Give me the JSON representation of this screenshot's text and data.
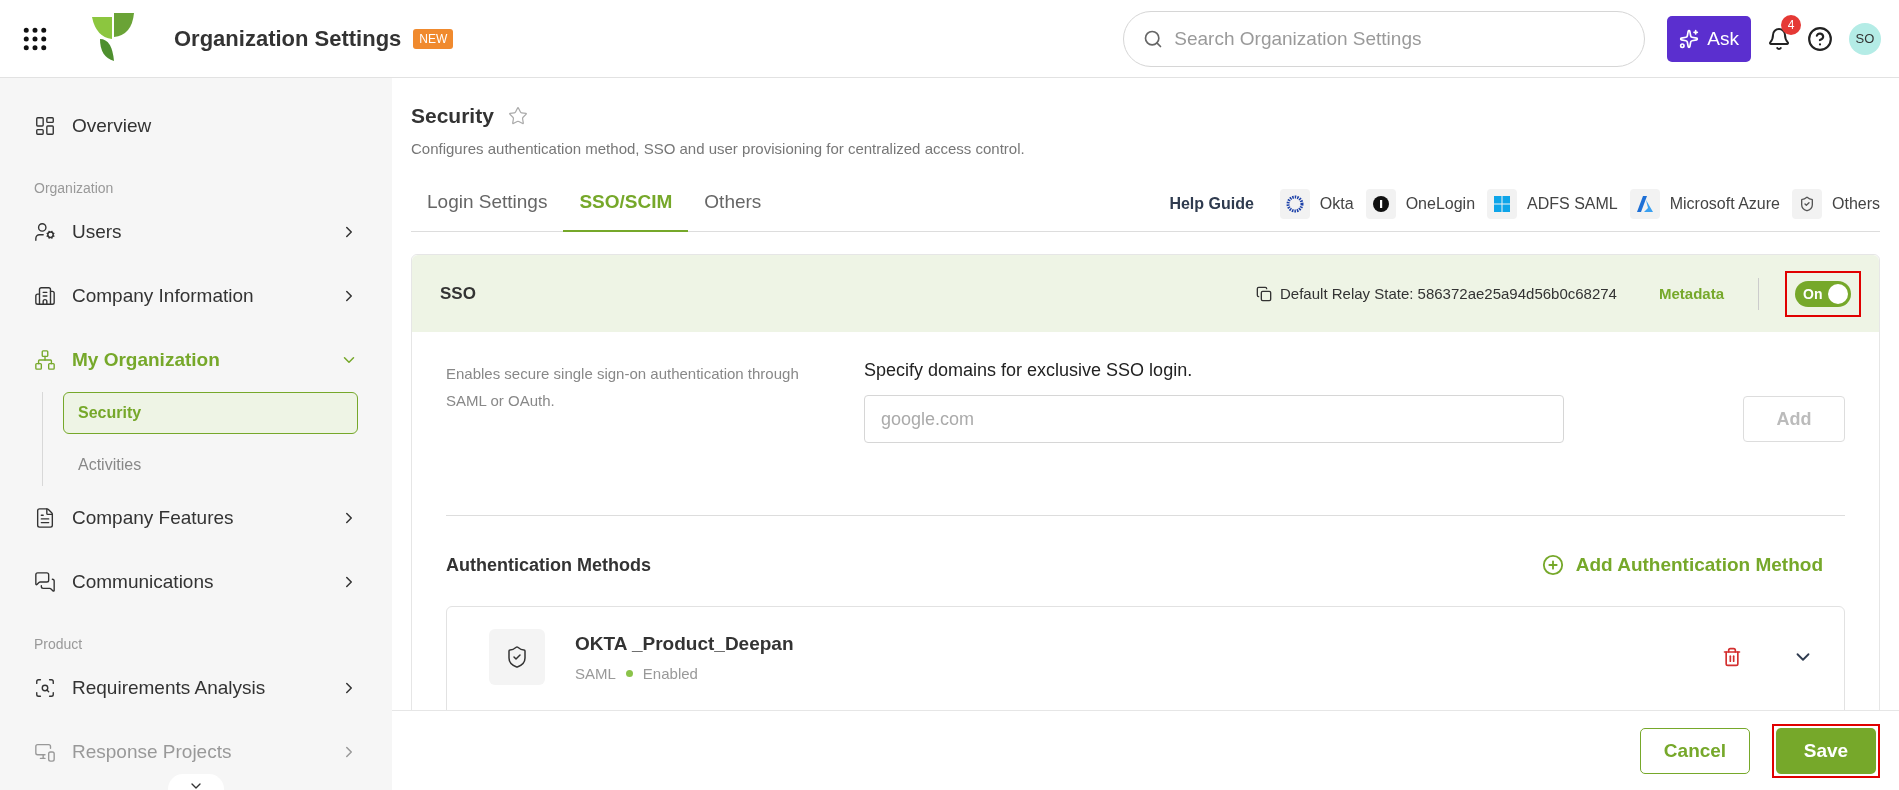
{
  "top_bar": {
    "title": "Organization Settings",
    "badge": "NEW",
    "search": {
      "placeholder": "Search Organization Settings"
    },
    "ask_button": "Ask",
    "notification_count": "4",
    "avatar": "SO"
  },
  "sidebar": {
    "items": [
      {
        "kind": "item",
        "label": "Overview",
        "expandable": false
      },
      {
        "kind": "section",
        "label": "Organization"
      },
      {
        "kind": "item",
        "label": "Users",
        "expandable": true,
        "expanded": false,
        "selected": false
      },
      {
        "kind": "item",
        "label": "Company Information",
        "expandable": true,
        "expanded": false,
        "selected": false
      },
      {
        "kind": "item",
        "label": "My Organization",
        "expandable": true,
        "expanded": true,
        "selected": true,
        "children": [
          {
            "label": "Security",
            "selected": true
          },
          {
            "label": "Activities",
            "selected": false
          }
        ]
      },
      {
        "kind": "item",
        "label": "Company Features",
        "expandable": true,
        "expanded": false,
        "selected": false
      },
      {
        "kind": "item",
        "label": "Communications",
        "expandable": true,
        "expanded": false,
        "selected": false
      },
      {
        "kind": "section",
        "label": "Product"
      },
      {
        "kind": "item",
        "label": "Requirements Analysis",
        "expandable": true,
        "expanded": false,
        "selected": false
      },
      {
        "kind": "item",
        "label": "Response Projects",
        "expandable": true,
        "expanded": false,
        "selected": false,
        "faded": true
      }
    ]
  },
  "page": {
    "title": "Security",
    "favorite": false,
    "description": "Configures authentication method, SSO and user provisioning for centralized access control."
  },
  "tabs": [
    {
      "label": "Login Settings",
      "selected": false
    },
    {
      "label": "SSO/SCIM",
      "selected": true
    },
    {
      "label": "Others",
      "selected": false
    }
  ],
  "help_guide": {
    "label": "Help Guide",
    "links": [
      "Okta",
      "OneLogin",
      "ADFS SAML",
      "Microsoft Azure",
      "Others"
    ]
  },
  "sso_panel": {
    "title": "SSO",
    "relay_state": "Default Relay State: 586372ae25a94d56b0c68274",
    "metadata_link": "Metadata",
    "toggle": {
      "label": "On",
      "on": true,
      "highlighted": true
    },
    "description": "Enables secure single sign-on authentication through SAML or OAuth.",
    "domains_label": "Specify domains for exclusive SSO login.",
    "domain_input": {
      "placeholder": "google.com"
    },
    "add_button": {
      "label": "Add",
      "disabled": true
    }
  },
  "authentication": {
    "title": "Authentication Methods",
    "add_link": "Add Authentication Method",
    "methods": [
      {
        "name": "OKTA _Product_Deepan",
        "type": "SAML",
        "status": "Enabled",
        "enabled": true,
        "expanded": false
      }
    ]
  },
  "footer": {
    "cancel": "Cancel",
    "save": {
      "label": "Save",
      "highlighted": true
    }
  }
}
